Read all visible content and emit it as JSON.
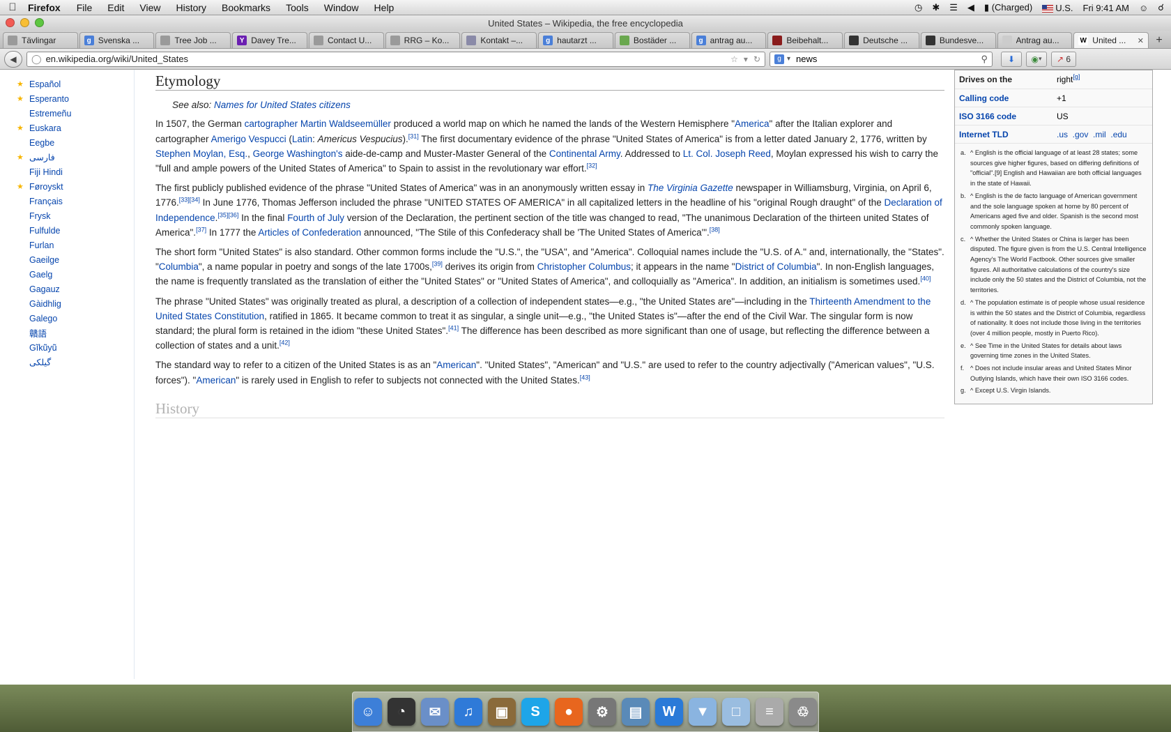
{
  "menubar": {
    "app": "Firefox",
    "items": [
      "File",
      "Edit",
      "View",
      "History",
      "Bookmarks",
      "Tools",
      "Window",
      "Help"
    ],
    "battery": "(Charged)",
    "input_source": "U.S.",
    "clock": "Fri 9:41 AM"
  },
  "window": {
    "title": "United States – Wikipedia, the free encyclopedia"
  },
  "tabs": [
    {
      "label": "Tävlingar",
      "icon": "page-icon",
      "color": "#9a9a9a"
    },
    {
      "label": "Svenska ...",
      "icon": "google-icon",
      "color": "#4a7fd8"
    },
    {
      "label": "Tree Job ...",
      "icon": "page-icon",
      "color": "#9a9a9a"
    },
    {
      "label": "Davey Tre...",
      "icon": "yahoo-icon",
      "color": "#6b1fb1"
    },
    {
      "label": "Contact U...",
      "icon": "page-icon",
      "color": "#9a9a9a"
    },
    {
      "label": "RRG – Ko...",
      "icon": "page-icon",
      "color": "#9a9a9a"
    },
    {
      "label": "Kontakt –...",
      "icon": "page-icon",
      "color": "#8a8aa8"
    },
    {
      "label": "hautarzt ...",
      "icon": "google-icon",
      "color": "#4a7fd8"
    },
    {
      "label": "Bostäder ...",
      "icon": "page-icon",
      "color": "#6aa84f"
    },
    {
      "label": "antrag au...",
      "icon": "google-icon",
      "color": "#4a7fd8"
    },
    {
      "label": "Beibehalt...",
      "icon": "page-icon",
      "color": "#8a1c1c"
    },
    {
      "label": "Deutsche ...",
      "icon": "page-icon",
      "color": "#333333"
    },
    {
      "label": "Bundesve...",
      "icon": "page-icon",
      "color": "#333333"
    },
    {
      "label": "Antrag au...",
      "icon": "page-icon",
      "color": "#cccccc"
    },
    {
      "label": "United ...",
      "icon": "wikipedia-icon",
      "color": "#ffffff",
      "active": true
    }
  ],
  "navbar": {
    "url": "en.wikipedia.org/wiki/United_States",
    "search_query": "news",
    "addon_count": "6"
  },
  "sidebar": {
    "languages": [
      {
        "name": "Español",
        "featured": true
      },
      {
        "name": "Esperanto",
        "featured": true
      },
      {
        "name": "Estremeñu",
        "featured": false
      },
      {
        "name": "Euskara",
        "featured": true
      },
      {
        "name": "Eegbe",
        "featured": false
      },
      {
        "name": "فارسی",
        "featured": true
      },
      {
        "name": "Fiji Hindi",
        "featured": false
      },
      {
        "name": "Føroyskt",
        "featured": true
      },
      {
        "name": "Français",
        "featured": false
      },
      {
        "name": "Frysk",
        "featured": false
      },
      {
        "name": "Fulfulde",
        "featured": false
      },
      {
        "name": "Furlan",
        "featured": false
      },
      {
        "name": "Gaeilge",
        "featured": false
      },
      {
        "name": "Gaelg",
        "featured": false
      },
      {
        "name": "Gagauz",
        "featured": false
      },
      {
        "name": "Gàidhlig",
        "featured": false
      },
      {
        "name": "Galego",
        "featured": false
      },
      {
        "name": "贛語",
        "featured": false
      },
      {
        "name": "Gĩkũyũ",
        "featured": false
      },
      {
        "name": "گیلکی",
        "featured": false
      }
    ]
  },
  "article": {
    "heading": "Etymology",
    "see_also_prefix": "See also: ",
    "see_also_link": "Names for United States citizens",
    "p1": {
      "t1": "In 1507, the German ",
      "l1": "cartographer",
      "t2": " ",
      "l2": "Martin Waldseemüller",
      "t3": " produced a world map on which he named the lands of the Western Hemisphere \"",
      "l3": "America",
      "t4": "\" after the Italian explorer and cartographer ",
      "l4": "Amerigo Vespucci",
      "t5": " (",
      "l5": "Latin",
      "t6": ": ",
      "i1": "Americus Vespucius",
      "t7": ").",
      "s1": "[31]",
      "t8": " The first documentary evidence of the phrase \"United States of America\" is from a letter dated January 2, 1776, written by ",
      "l6": "Stephen Moylan, Esq.",
      "t9": ", ",
      "l7": "George Washington's",
      "t10": " aide-de-camp and Muster-Master General of the ",
      "l8": "Continental Army",
      "t11": ". Addressed to ",
      "l9": "Lt. Col. Joseph Reed",
      "t12": ", Moylan expressed his wish to carry the \"full and ample powers of the United States of America\" to Spain to assist in the revolutionary war effort.",
      "s2": "[32]"
    },
    "p2": {
      "t1": "The first publicly published evidence of the phrase \"United States of America\" was in an anonymously written essay in ",
      "l1": "The Virginia Gazette",
      "t2": " newspaper in Williamsburg, Virginia, on April 6, 1776.",
      "s1": "[33][34]",
      "t3": " In June 1776, Thomas Jefferson included the phrase \"UNITED STATES OF AMERICA\" in all capitalized letters in the headline of his \"original Rough draught\" of the ",
      "l2": "Declaration of Independence",
      "t4": ".",
      "s2": "[35][36]",
      "t5": " In the final ",
      "l3": "Fourth of July",
      "t6": " version of the Declaration, the pertinent section of the title was changed to read, \"The unanimous Declaration of the thirteen united States of America\".",
      "s3": "[37]",
      "t7": " In 1777 the ",
      "l4": "Articles of Confederation",
      "t8": " announced, \"The Stile of this Confederacy shall be 'The United States of America'\".",
      "s4": "[38]"
    },
    "p3": {
      "t1": "The short form \"United States\" is also standard. Other common forms include the \"U.S.\", the \"USA\", and \"America\". Colloquial names include the \"U.S. of A.\" and, internationally, the \"States\". \"",
      "l1": "Columbia",
      "t2": "\", a name popular in poetry and songs of the late 1700s,",
      "s1": "[39]",
      "t3": " derives its origin from ",
      "l2": "Christopher Columbus",
      "t4": "; it appears in the name \"",
      "l3": "District of Columbia",
      "t5": "\". In non-English languages, the name is frequently translated as the translation of either the \"United States\" or \"United States of America\", and colloquially as \"America\". In addition, an initialism is sometimes used.",
      "s2": "[40]"
    },
    "p4": {
      "t1": "The phrase \"United States\" was originally treated as plural, a description of a collection of independent states—e.g., \"the United States are\"—including in the ",
      "l1": "Thirteenth Amendment to the United States Constitution",
      "t2": ", ratified in 1865. It became common to treat it as singular, a single unit—e.g., \"the United States is\"—after the end of the Civil War. The singular form is now standard; the plural form is retained in the idiom \"these United States\".",
      "s1": "[41]",
      "t3": " The difference has been described as more significant than one of usage, but reflecting the difference between a collection of states and a unit.",
      "s2": "[42]"
    },
    "p5": {
      "t1": "The standard way to refer to a citizen of the United States is as an \"",
      "l1": "American",
      "t2": "\". \"United States\", \"American\" and \"U.S.\" are used to refer to the country adjectivally (\"American values\", \"U.S. forces\"). \"",
      "l2": "American",
      "t3": "\" is rarely used in English to refer to subjects not connected with the United States.",
      "s1": "[43]"
    },
    "heading2": "History"
  },
  "infobox": {
    "rows": [
      {
        "key": "Drives on the",
        "value": "right",
        "sup": "[g]",
        "key_link": false
      },
      {
        "key": "Calling code",
        "value": "+1",
        "sup": "",
        "key_link": true
      },
      {
        "key": "ISO 3166 code",
        "value": "US",
        "sup": "",
        "key_link": true
      },
      {
        "key": "Internet TLD",
        "value": ".us  .gov  .mil  .edu",
        "sup": "",
        "key_link": true
      }
    ],
    "notes": [
      {
        "marker": "a.",
        "text": "^ English is the official language of at least 28 states; some sources give higher figures, based on differing definitions of \"official\".[9] English and Hawaiian are both official languages in the state of Hawaii."
      },
      {
        "marker": "b.",
        "text": "^ English is the de facto language of American government and the sole language spoken at home by 80 percent of Americans aged five and older. Spanish is the second most commonly spoken language."
      },
      {
        "marker": "c.",
        "text": "^ Whether the United States or China is larger has been disputed. The figure given is from the U.S. Central Intelligence Agency's The World Factbook. Other sources give smaller figures. All authoritative calculations of the country's size include only the 50 states and the District of Columbia, not the territories."
      },
      {
        "marker": "d.",
        "text": "^ The population estimate is of people whose usual residence is within the 50 states and the District of Columbia, regardless of nationality. It does not include those living in the territories (over 4 million people, mostly in Puerto Rico)."
      },
      {
        "marker": "e.",
        "text": "^ See Time in the United States for details about laws governing time zones in the United States."
      },
      {
        "marker": "f.",
        "text": "^ Does not include insular areas and United States Minor Outlying Islands, which have their own ISO 3166 codes."
      },
      {
        "marker": "g.",
        "text": "^ Except U.S. Virgin Islands."
      }
    ]
  },
  "dock": {
    "apps": [
      {
        "name": "finder-icon",
        "color": "#3d7fd8",
        "glyph": "☺"
      },
      {
        "name": "dashboard-icon",
        "color": "#333333",
        "glyph": "◔"
      },
      {
        "name": "mail-icon",
        "color": "#6a8fc8",
        "glyph": "✉"
      },
      {
        "name": "itunes-icon",
        "color": "#2f7ad8",
        "glyph": "♫"
      },
      {
        "name": "iphoto-icon",
        "color": "#8a6a3a",
        "glyph": "▣"
      },
      {
        "name": "skype-icon",
        "color": "#1ea5e8",
        "glyph": "S"
      },
      {
        "name": "firefox-icon",
        "color": "#e8661e",
        "glyph": "●"
      },
      {
        "name": "system-preferences-icon",
        "color": "#777777",
        "glyph": "⚙"
      },
      {
        "name": "preview-icon",
        "color": "#5a8ab8",
        "glyph": "▤"
      },
      {
        "name": "word-icon",
        "color": "#2a7ad8",
        "glyph": "W"
      },
      {
        "name": "downloads-folder-icon",
        "color": "#8ab4e0",
        "glyph": "▼"
      },
      {
        "name": "documents-folder-icon",
        "color": "#9abde0",
        "glyph": "□"
      },
      {
        "name": "stack-icon",
        "color": "#aaaaaa",
        "glyph": "≡"
      },
      {
        "name": "trash-icon",
        "color": "#8a8a8a",
        "glyph": "♲"
      }
    ]
  }
}
